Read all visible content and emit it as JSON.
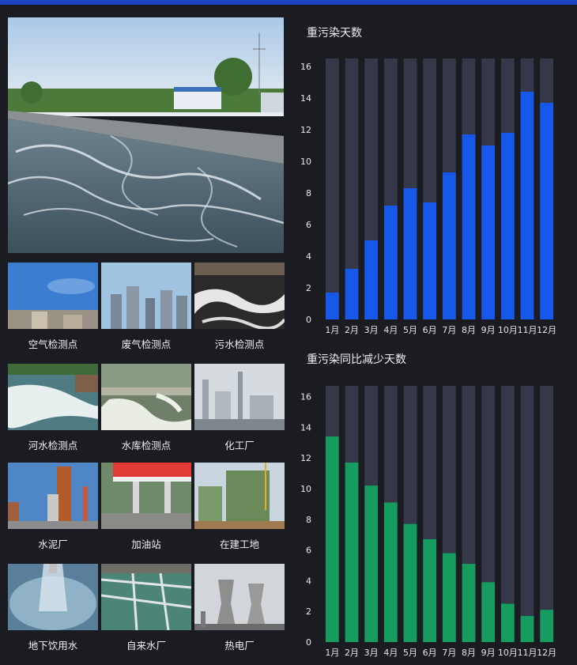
{
  "tiles": [
    {
      "label": "空气检测点"
    },
    {
      "label": "废气检测点"
    },
    {
      "label": "污水检测点"
    },
    {
      "label": "河水检测点"
    },
    {
      "label": "水库检测点"
    },
    {
      "label": "化工厂"
    },
    {
      "label": "水泥厂"
    },
    {
      "label": "加油站"
    },
    {
      "label": "在建工地"
    },
    {
      "label": "地下饮用水"
    },
    {
      "label": "自来水厂"
    },
    {
      "label": "热电厂"
    }
  ],
  "chart_data": [
    {
      "type": "bar",
      "title": "重污染天数",
      "categories": [
        "1月",
        "2月",
        "3月",
        "4月",
        "5月",
        "6月",
        "7月",
        "8月",
        "9月",
        "10月",
        "11月",
        "12月"
      ],
      "values": [
        1.7,
        3.2,
        5.0,
        7.2,
        8.3,
        7.4,
        9.3,
        11.7,
        11.0,
        11.8,
        14.4,
        13.7
      ],
      "ylim": [
        0,
        16.5
      ],
      "yticks": [
        0,
        2,
        4,
        6,
        8,
        10,
        12,
        14,
        16
      ],
      "bar_color": "#1659ea",
      "background_bar_color": "#343849",
      "grid": false
    },
    {
      "type": "bar",
      "title": "重污染同比减少天数",
      "categories": [
        "1月",
        "2月",
        "3月",
        "4月",
        "5月",
        "6月",
        "7月",
        "8月",
        "9月",
        "10月",
        "11月",
        "12月"
      ],
      "values": [
        13.4,
        11.7,
        10.2,
        9.1,
        7.7,
        6.7,
        5.8,
        5.1,
        3.9,
        2.5,
        1.7,
        2.1
      ],
      "ylim": [
        0,
        16.7
      ],
      "yticks": [
        0,
        2,
        4,
        6,
        8,
        10,
        12,
        14,
        16
      ],
      "bar_color": "#169c5f",
      "background_bar_color": "#343849",
      "grid": false
    }
  ]
}
